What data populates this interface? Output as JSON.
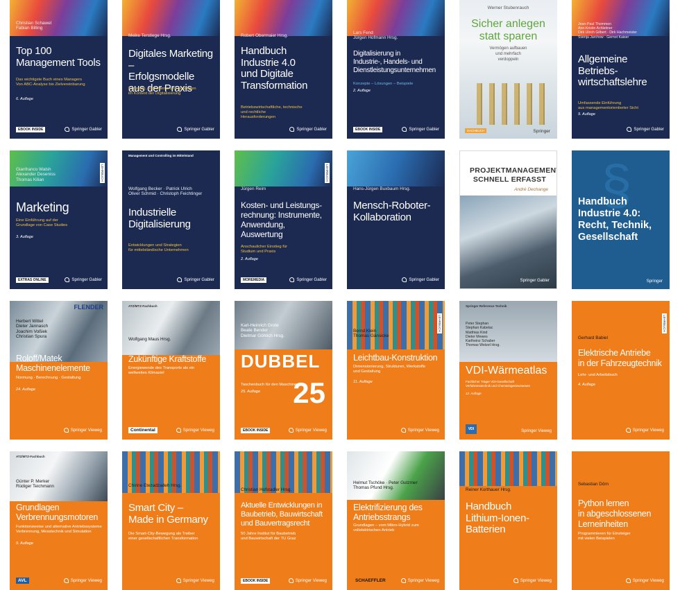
{
  "books": [
    {
      "authors": "Christian Schawel\nFabian Billing",
      "title": "Top 100\nManagement Tools",
      "subtitle": "Das wichtigste Buch eines Managers\nVon ABC-Analyse bis Zielvereinbarung",
      "edition": "6. Auflage",
      "badge": "EBOOK INSIDE",
      "publisher": "Springer Gabler"
    },
    {
      "authors": "Meike Terstiege Hrsg.",
      "title": "Digitales Marketing –\nErfolgsmodelle\naus der Praxis",
      "subtitle": "Konzepte, Instrumente und Strategien\nim Kontext der Digitalisierung",
      "publisher": "Springer Gabler"
    },
    {
      "authors": "Robert Obermaier Hrsg.",
      "title": "Handbuch\nIndustrie 4.0\nund Digitale\nTransformation",
      "subtitle": "Betriebswirtschaftliche, technische\nund rechtliche\nHerausforderungen",
      "publisher": "Springer Gabler"
    },
    {
      "authors": "Lars Fend\nJürgen Hofmann Hrsg.",
      "title": "Digitalisierung in\nIndustrie-, Handels- und\nDienstleistungsunternehmen",
      "subtitle": "Konzepte – Lösungen – Beispiele",
      "edition": "2. Auflage",
      "badge": "EBOOK INSIDE",
      "publisher": "Springer Gabler"
    },
    {
      "author": "Werner Stubenrauch",
      "title": "Sicher anlegen\nstatt sparen",
      "subtitle": "Vermögen aufbauen\nund mehrfach\nverdoppeln",
      "badge": "SACHBUCH",
      "publisher": "Springer"
    },
    {
      "authors": "Jean-Paul Thommen\nAnn-Kristin Achleitner\nDirk Ulrich Gilbert · Dirk Hachmeister\nSvenja Jarchow · Gernot Kaiser",
      "title": "Allgemeine\nBetriebs-\nwirtschaftslehre",
      "subtitle": "Umfassende Einführung\naus managementorientierter Sicht",
      "edition": "9. Auflage",
      "publisher": "Springer Gabler"
    },
    {
      "authors": "Gianfranco Walsh\nAlexander Deseniss\nThomas Kilian",
      "title": "Marketing",
      "subtitle": "Eine Einführung auf der\nGrundlage von Case Studies",
      "edition": "3. Auflage",
      "badge": "EXTRAS ONLINE",
      "publisher": "Springer Gabler",
      "lehrbuch": "LEHRBUCH"
    },
    {
      "series": "Management und Controlling im Mittelstand",
      "authors": "Wolfgang Becker · Patrick Ulrich\nOliver Schmid · Christoph Feichtinger",
      "title": "Industrielle\nDigitalisierung",
      "subtitle": "Entwicklungen und Strategien\nfür mittelständische Unternehmen",
      "publisher": "Springer Gabler"
    },
    {
      "authors": "Jürgen Reim",
      "title": "Kosten- und Leistungs-\nrechnung: Instrumente,\nAnwendung,\nAuswertung",
      "subtitle": "Anschaulicher Einstieg für\nStudium und Praxis",
      "edition": "2. Auflage",
      "badge": "MOREMEDIA",
      "publisher": "Springer Gabler",
      "lehrbuch": "LEHRBUCH"
    },
    {
      "authors": "Hans-Jürgen Buxbaum Hrsg.",
      "title": "Mensch-Roboter-\nKollaboration",
      "publisher": "Springer Gabler"
    },
    {
      "title": "PROJEKTMANAGEMENT\nSCHNELL ERFASST",
      "author": "André Dechange",
      "publisher": "Springer Gabler"
    },
    {
      "title": "Handbuch\nIndustrie 4.0:\nRecht, Technik,\nGesellschaft",
      "publisher": "Springer"
    },
    {
      "logo": "FLENDER",
      "authors": "Herbert Wittel\nDieter Jannasch\nJoachim Voßiek\nChristian Spura",
      "title": "Roloff/Matek\nMaschinenelemente",
      "subtitle": "Normung · Berechnung · Gestaltung",
      "edition": "24. Auflage",
      "publisher": "Springer Vieweg"
    },
    {
      "series": "ATZ/MTZ-Fachbuch",
      "authors": "Wolfgang Maus Hrsg.",
      "title": "Zukünftige Kraftstoffe",
      "subtitle": "Energiewende des Transports als ein\nweltweites Klimaziel",
      "logo": "Continental",
      "publisher": "Springer Vieweg"
    },
    {
      "authors": "Karl-Heinrich Grote\nBeate Bender\nDietmar Göhlich Hrsg.",
      "title": "DUBBEL",
      "subtitle": "Taschenbuch für den Maschinenbau",
      "edition": "25. Auflage",
      "number": "25",
      "badge": "EBOOK INSIDE",
      "publisher": "Springer Vieweg"
    },
    {
      "authors": "Bernd Klein\nThomas Gänsicke",
      "title": "Leichtbau-Konstruktion",
      "subtitle": "Dimensionierung, Strukturen, Werkstoffe\nund Gestaltung",
      "edition": "11. Auflage",
      "publisher": "Springer Vieweg",
      "lehrbuch": "LEHRBUCH"
    },
    {
      "series": "Springer Reference Technik",
      "authors": "Peter Stephan\nStephan Kabelac\nMatthias Kind\nDieter Mewes\nKarlheinz Schaber\nThomas Wetzel Hrsg.",
      "title": "VDI-Wärmeatlas",
      "subtitle": "Fachlicher Träger VDI-Gesellschaft\nVerfahrenstechnik und Chemieingenieurwesen",
      "edition": "12. Auflage",
      "logo": "VDI",
      "publisher": "Springer Vieweg"
    },
    {
      "authors": "Gerhard Babiel",
      "title": "Elektrische Antriebe\nin der Fahrzeugtechnik",
      "subtitle": "Lehr- und Arbeitsbuch",
      "edition": "4. Auflage",
      "publisher": "Springer Vieweg",
      "lehrbuch": "LEHRBUCH"
    },
    {
      "series": "ATZ/MTZ-Fachbuch",
      "authors": "Günter P. Merker\nRüdiger Teichmann",
      "title": "Grundlagen\nVerbrennungsmotoren",
      "subtitle": "Funktionsweise und alternative Antriebssysteme\nVerbrennung, Messtechnik und Simulation",
      "edition": "9. Auflage",
      "logo": "AVL",
      "publisher": "Springer Vieweg"
    },
    {
      "authors": "Chirine Etezadzadeh Hrsg.",
      "title": "Smart City –\nMade in Germany",
      "subtitle": "Die Smart-City-Bewegung als Treiber\neiner gesellschaftlichen Transformation",
      "publisher": "Springer Vieweg"
    },
    {
      "authors": "Christian Hofstadler Hrsg.",
      "title": "Aktuelle Entwicklungen in\nBaubetrieb, Bauwirtschaft\nund Bauvertragsrecht",
      "subtitle": "50 Jahre Institut für Baubetrieb\nund Bauwirtschaft der TU Graz",
      "badge": "EBOOK INSIDE",
      "publisher": "Springer Vieweg"
    },
    {
      "authors": "Helmut Tschöke · Peter Gutzmer\nThomas Pfund Hrsg.",
      "title": "Elektrifizierung des\nAntriebsstrangs",
      "subtitle": "Grundlagen – vom Mikro-Hybrid zum\nvollelektrischen Antrieb",
      "logo": "SCHAEFFLER",
      "publisher": "Springer Vieweg"
    },
    {
      "authors": "Reiner Korthauer Hrsg.",
      "title": "Handbuch\nLithium-Ionen-\nBatterien",
      "publisher": "Springer Vieweg"
    },
    {
      "authors": "Sebastian Dörn",
      "title": "Python lernen\nin abgeschlossenen\nLerneinheiten",
      "subtitle": "Programmieren für Einsteiger\nmit vielen Beispielen",
      "publisher": "Springer Vieweg"
    }
  ]
}
